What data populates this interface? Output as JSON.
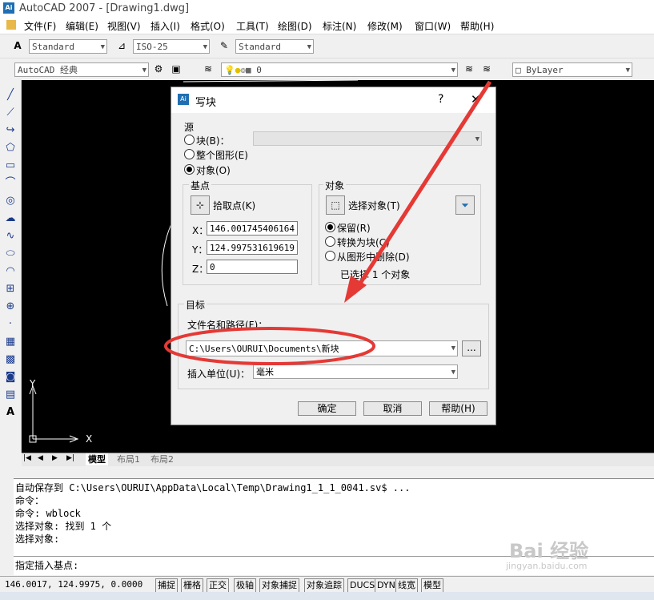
{
  "window": {
    "title": "AutoCAD 2007 - [Drawing1.dwg]",
    "logo_text": "Ai"
  },
  "menu": [
    "文件(F)",
    "编辑(E)",
    "视图(V)",
    "插入(I)",
    "格式(O)",
    "工具(T)",
    "绘图(D)",
    "标注(N)",
    "修改(M)",
    "窗口(W)",
    "帮助(H)"
  ],
  "toolbar1": {
    "text_style": "Standard",
    "dim_style": "ISO-25",
    "table_style": "Standard"
  },
  "toolbar2": {
    "workspace": "AutoCAD 经典",
    "layer": "0",
    "color": "ByLayer"
  },
  "dialog": {
    "title": "写块",
    "help_label": "?",
    "close_label": "✕",
    "source": {
      "label": "源",
      "block_option": "块(B)：",
      "entire_drawing_option": "整个图形(E)",
      "objects_option": "对象(O)"
    },
    "base_point": {
      "label": "基点",
      "pick_label": "拾取点(K)",
      "x_label": "X：",
      "x_value": "146.001745406164",
      "y_label": "Y：",
      "y_value": "124.997531619619",
      "z_label": "Z：",
      "z_value": "0"
    },
    "objects": {
      "label": "对象",
      "select_label": "选择对象(T)",
      "retain_option": "保留(R)",
      "convert_option": "转换为块(C)",
      "delete_option": "从图形中删除(D)",
      "status": "已选择 1 个对象"
    },
    "target": {
      "label": "目标",
      "path_label": "文件名和路径(F)：",
      "path_value": "C:\\Users\\OURUI\\Documents\\新块",
      "browse_label": "...",
      "units_label": "插入单位(U)：",
      "units_value": "毫米"
    },
    "buttons": {
      "ok": "确定",
      "cancel": "取消",
      "help": "帮助(H)"
    }
  },
  "ucs": {
    "x": "X",
    "y": "Y"
  },
  "tabs": [
    "模型",
    "布局1",
    "布局2"
  ],
  "command_lines": [
    "自动保存到 C:\\Users\\OURUI\\AppData\\Local\\Temp\\Drawing1_1_1_0041.sv$ ...",
    "命令：",
    "命令: wblock",
    "选择对象: 找到 1 个",
    "选择对象:"
  ],
  "prompt": "指定插入基点:",
  "status": {
    "coords": "146.0017, 124.9975, 0.0000",
    "buttons": [
      "捕捉",
      "栅格",
      "正交",
      "极轴",
      "对象捕捉",
      "对象追踪",
      "DUCS",
      "DYN",
      "线宽",
      "模型"
    ]
  },
  "watermark": {
    "text": "Bai 经验",
    "sub": "jingyan.baidu.com"
  },
  "colors": {
    "annotation": "#e53935",
    "canvas": "#000000"
  }
}
